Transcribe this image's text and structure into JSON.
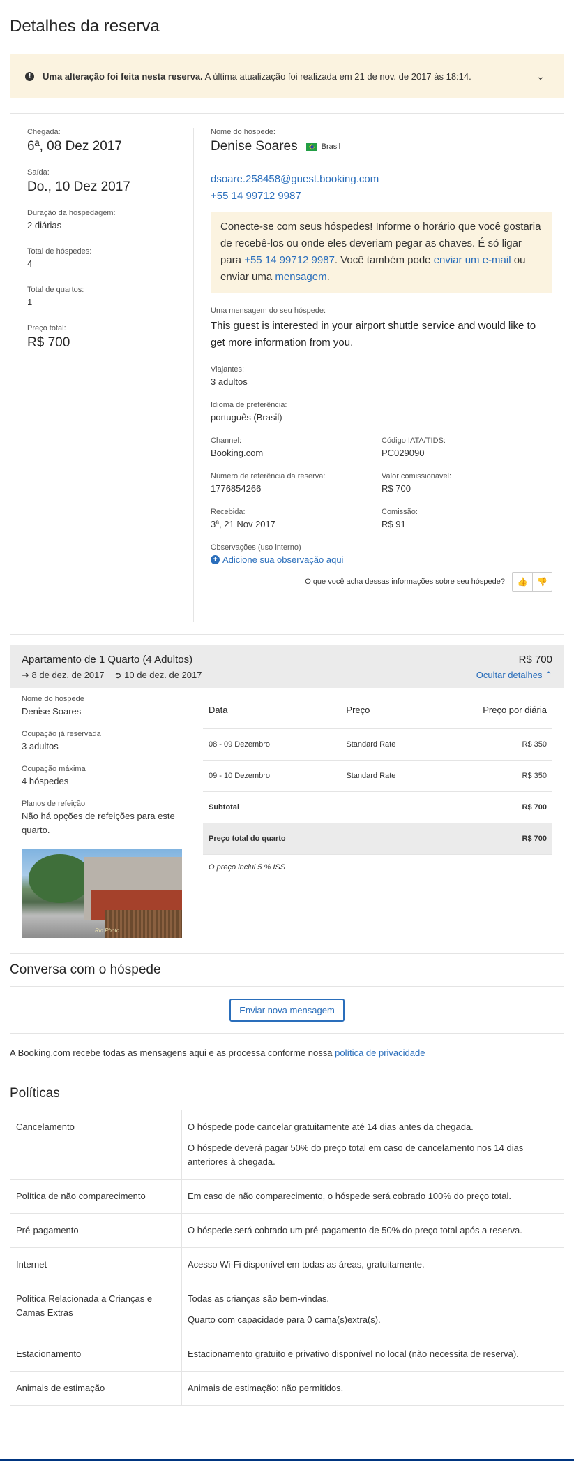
{
  "page_title": "Detalhes da reserva",
  "alert": {
    "bold": "Uma alteração foi feita nesta reserva.",
    "text": " A última atualização foi realizada em 21 de nov. de 2017 às 18:14."
  },
  "summary": {
    "checkin_label": "Chegada:",
    "checkin": "6ª, 08 Dez 2017",
    "checkout_label": "Saída:",
    "checkout": "Do., 10 Dez 2017",
    "duration_label": "Duração da hospedagem:",
    "duration": "2 diárias",
    "guests_label": "Total de hóspedes:",
    "guests": "4",
    "rooms_label": "Total de quartos:",
    "rooms": "1",
    "price_label": "Preço total:",
    "price": "R$ 700"
  },
  "guest": {
    "name_label": "Nome do hóspede:",
    "name": "Denise Soares",
    "country": "Brasil",
    "email": "dsoare.258458@guest.booking.com",
    "phone": "+55 14 99712 9987",
    "tip_1": "Conecte-se com seus hóspedes! Informe o horário que você gostaria de recebê-los ou onde eles deveriam pegar as chaves. É só ligar para ",
    "tip_phone": "+55 14 99712 9987",
    "tip_2": ". Você também pode ",
    "tip_email_link": "enviar um e-mail",
    "tip_3": " ou enviar uma ",
    "tip_msg_link": "mensagem",
    "tip_4": ".",
    "message_label": "Uma mensagem do seu hóspede:",
    "message": "This guest is interested in your airport shuttle service and would like to get more information from you.",
    "travelers_label": "Viajantes:",
    "travelers": "3 adultos",
    "language_label": "Idioma de preferência:",
    "language": "português (Brasil)",
    "channel_label": "Channel:",
    "channel": "Booking.com",
    "iata_label": "Código IATA/TIDS:",
    "iata": "PC029090",
    "ref_label": "Número de referência da reserva:",
    "ref": "1776854266",
    "commissionable_label": "Valor comissionável:",
    "commissionable": "R$ 700",
    "received_label": "Recebida:",
    "received": "3ª, 21 Nov 2017",
    "commission_label": "Comissão:",
    "commission": "R$ 91",
    "notes_label": "Observações (uso interno)",
    "add_note": "Adicione sua observação aqui",
    "feedback_question": "O que você acha dessas informações sobre seu hóspede?"
  },
  "room": {
    "title": "Apartamento de 1 Quarto (4 Adultos)",
    "checkin": "8 de dez. de 2017",
    "checkout": "10 de dez. de 2017",
    "price": "R$ 700",
    "hide_details": "Ocultar detalhes",
    "guest_name_label": "Nome do hóspede",
    "guest_name": "Denise Soares",
    "occupancy_label": "Ocupação já reservada",
    "occupancy": "3 adultos",
    "max_label": "Ocupação máxima",
    "max": "4 hóspedes",
    "meals_label": "Planos de refeição",
    "meals": "Não há opções de refeições para este quarto.",
    "photo_watermark": "Rio Photo",
    "table_headers": [
      "Data",
      "Preço",
      "Preço por diária"
    ],
    "rows": [
      {
        "date": "08 - 09 Dezembro",
        "rate": "Standard Rate",
        "price": "R$ 350"
      },
      {
        "date": "09 - 10 Dezembro",
        "rate": "Standard Rate",
        "price": "R$ 350"
      }
    ],
    "subtotal_label": "Subtotal",
    "subtotal": "R$ 700",
    "total_label": "Preço total do quarto",
    "total": "R$ 700",
    "tax_note": "O preço inclui 5 % ISS"
  },
  "conversation": {
    "title": "Conversa com o hóspede",
    "button": "Enviar nova mensagem",
    "privacy_text": "A Booking.com recebe todas as mensagens aqui e as processa conforme nossa ",
    "privacy_link": "política de privacidade"
  },
  "policies": {
    "title": "Políticas",
    "rows": [
      {
        "key": "Cancelamento",
        "values": [
          "O hóspede pode cancelar gratuitamente até 14 dias antes da chegada.",
          "O hóspede deverá pagar 50% do preço total em caso de cancelamento nos 14 dias anteriores à chegada."
        ]
      },
      {
        "key": "Política de não comparecimento",
        "values": [
          "Em caso de não comparecimento, o hóspede será cobrado 100% do preço total."
        ]
      },
      {
        "key": "Pré-pagamento",
        "values": [
          "O hóspede será cobrado um pré-pagamento de 50% do preço total após a reserva."
        ]
      },
      {
        "key": "Internet",
        "values": [
          "Acesso Wi-Fi disponível em todas as áreas, gratuitamente."
        ]
      },
      {
        "key": "Política Relacionada a Crianças e Camas Extras",
        "values": [
          "Todas as crianças são bem-vindas.",
          "Quarto com capacidade para 0 cama(s)extra(s)."
        ]
      },
      {
        "key": "Estacionamento",
        "values": [
          "Estacionamento gratuito e privativo disponível no local (não necessita de reserva)."
        ]
      },
      {
        "key": "Animais de estimação",
        "values": [
          "Animais de estimação: não permitidos."
        ]
      }
    ]
  },
  "colors": {
    "link": "#2a6ebb",
    "alert_bg": "#fbf3e0",
    "header_bg": "#ebebeb",
    "footer_bar": "#003580"
  }
}
